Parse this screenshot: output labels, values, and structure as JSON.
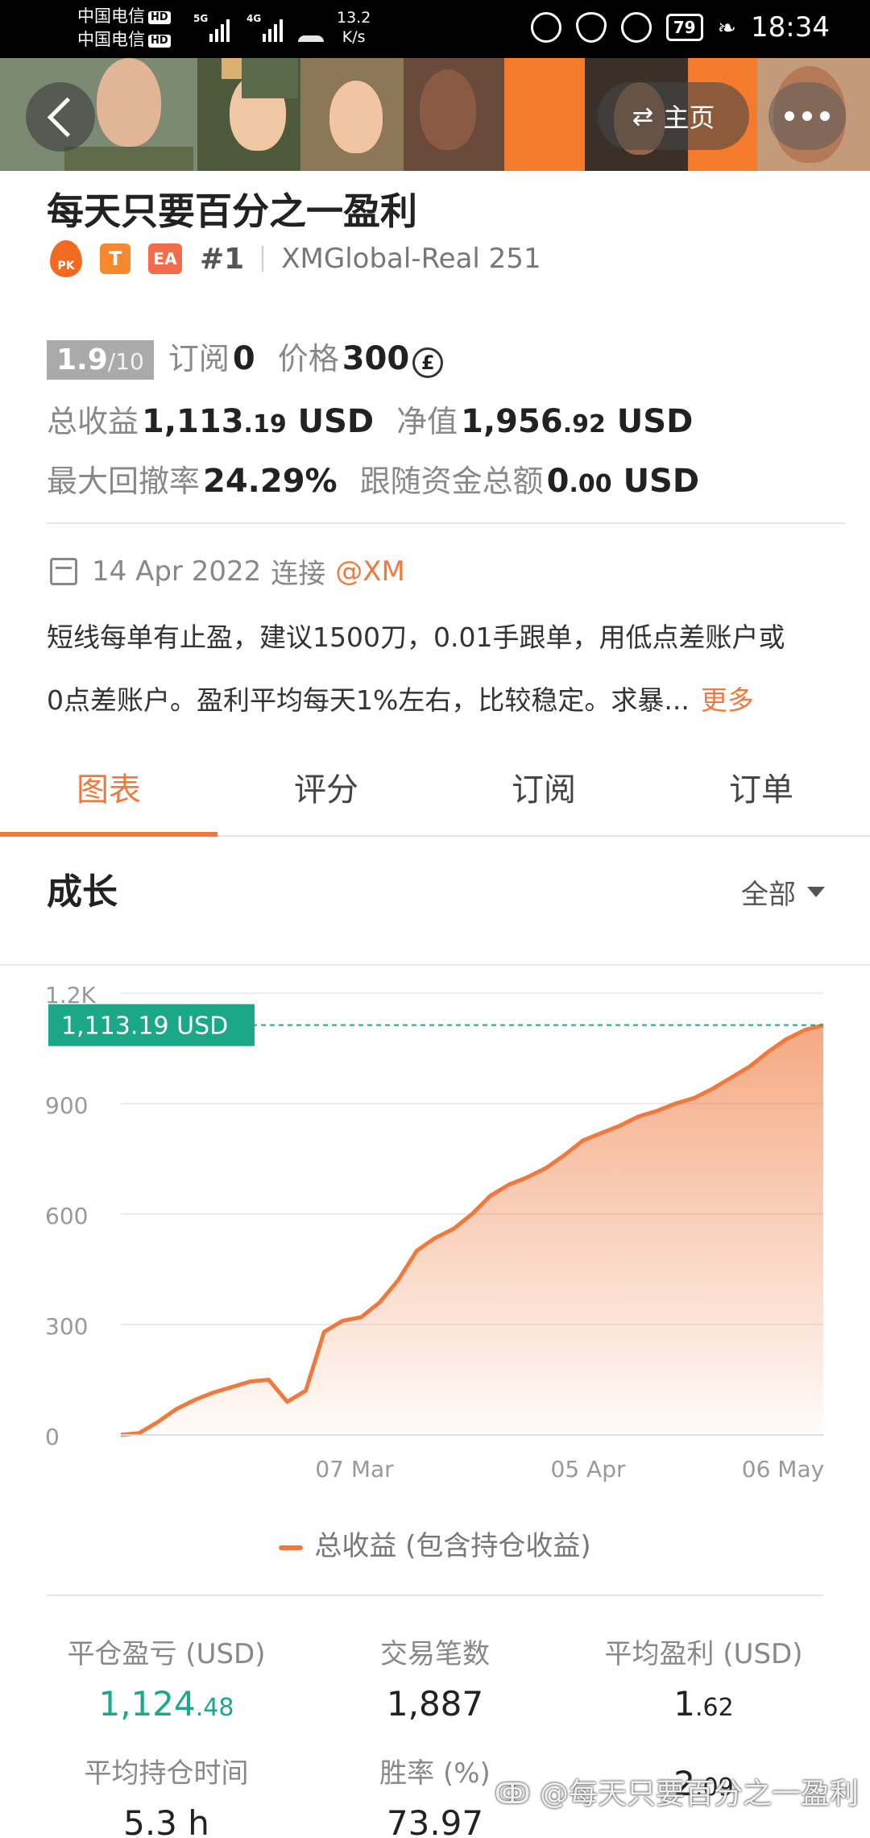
{
  "status_bar": {
    "carrier_1": "中国电信",
    "carrier_2": "中国电信",
    "hd": "HD",
    "net_1": "5G",
    "net_2": "4G",
    "speed_value": "13.2",
    "speed_unit": "K/s",
    "battery": "79",
    "time": "18:34"
  },
  "header": {
    "home_label": "主页"
  },
  "signal": {
    "name": "每天只要百分之一盈利",
    "tag_pk": "PK",
    "tag_t": "T",
    "tag_ea": "EA",
    "rank": "#1",
    "account": "XMGlobal-Real 251"
  },
  "stats": {
    "score": "1.9",
    "score_max": "/10",
    "subscribe_label": "订阅",
    "subscribe_value": "0",
    "price_label": "价格",
    "price_value": "300",
    "price_icon": "£",
    "total_profit_label": "总收益",
    "total_profit_int": "1,113",
    "total_profit_dec": ".19",
    "total_profit_unit": "USD",
    "equity_label": "净值",
    "equity_int": "1,956",
    "equity_dec": ".92",
    "equity_unit": "USD",
    "drawdown_label": "最大回撤率",
    "drawdown_value": "24.29%",
    "follow_label": "跟随资金总额",
    "follow_int": "0",
    "follow_dec": ".00",
    "follow_unit": "USD"
  },
  "connection": {
    "date": "14 Apr 2022",
    "connect_label": "连接",
    "broker": "@XM"
  },
  "description": {
    "line1": "短线每单有止盈，建议1500刀，0.01手跟单，用低点差账户或",
    "line2": "0点差账户。盈利平均每天1%左右，比较稳定。求暴...",
    "more": "更多"
  },
  "tabs": [
    "图表",
    "评分",
    "订阅",
    "订单"
  ],
  "growth": {
    "title": "成长",
    "filter": "全部"
  },
  "chart_data": {
    "type": "area",
    "y_ticks": [
      "0",
      "300",
      "600",
      "900",
      "1.2K"
    ],
    "x_ticks": [
      "07 Mar",
      "05 Apr",
      "06 May"
    ],
    "ylim": [
      0,
      1200
    ],
    "current_label": "1,113.19 USD",
    "current_value": 1113.19,
    "legend": "总收益 (包含持仓收益)",
    "series": [
      {
        "name": "总收益 (包含持仓收益)",
        "values": [
          0,
          5,
          35,
          70,
          95,
          115,
          130,
          145,
          150,
          90,
          120,
          280,
          310,
          320,
          360,
          420,
          500,
          535,
          560,
          600,
          650,
          680,
          700,
          725,
          760,
          800,
          820,
          840,
          865,
          880,
          900,
          915,
          940,
          970,
          1000,
          1040,
          1075,
          1100,
          1113.19
        ]
      }
    ]
  },
  "metrics": [
    {
      "label": "平仓盈亏 (USD)",
      "int": "1,124",
      "dec": ".48",
      "green": true
    },
    {
      "label": "交易笔数",
      "int": "1,887",
      "dec": "",
      "green": false
    },
    {
      "label": "平均盈利 (USD)",
      "int": "1",
      "dec": ".62",
      "green": false
    },
    {
      "label": "平均持仓时间",
      "int": "5.3 h",
      "dec": "",
      "green": false
    },
    {
      "label": "胜率 (%)",
      "int": "73.97",
      "dec": "",
      "green": false
    },
    {
      "label": "",
      "int": "2",
      "dec": ".09",
      "green": false
    }
  ],
  "watermark": "每天只要百分之一盈利",
  "colors": {
    "accent": "#f07a3e",
    "green": "#1aa889",
    "chart_line": "#f07a3e"
  }
}
